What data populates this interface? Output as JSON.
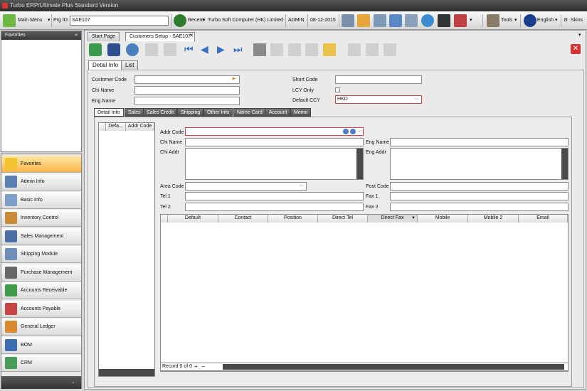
{
  "window": {
    "title": "Turbo ERP/Ultimate Plus Standard Version"
  },
  "toolbar": {
    "main_menu": "Main Menu",
    "prg_id_label": "Prg ID:",
    "prg_id_value": "SAE107",
    "recent": "Recent",
    "company": "Turbo Soft Computer (HK) Limited",
    "user": "ADMIN",
    "date": "08-12-2015",
    "tools": "Tools",
    "language": "English",
    "skins": "Skins"
  },
  "favorites": {
    "title": "Favorites"
  },
  "nav": {
    "items": [
      {
        "label": "Favorites",
        "icon": "star-icon"
      },
      {
        "label": "Admin Info",
        "icon": "admin-icon"
      },
      {
        "label": "Basic Info",
        "icon": "basic-info-icon"
      },
      {
        "label": "Inventory Control",
        "icon": "inventory-icon"
      },
      {
        "label": "Sales Management",
        "icon": "sales-icon"
      },
      {
        "label": "Shipping Module",
        "icon": "shipping-icon"
      },
      {
        "label": "Purchase Management",
        "icon": "purchase-icon"
      },
      {
        "label": "Accounts Receivable",
        "icon": "receivable-icon"
      },
      {
        "label": "Accounts Payable",
        "icon": "payable-icon"
      },
      {
        "label": "General Ledger",
        "icon": "ledger-icon"
      },
      {
        "label": "BOM",
        "icon": "bom-icon"
      },
      {
        "label": "CRM",
        "icon": "crm-icon"
      }
    ]
  },
  "doc_tabs": {
    "start": "Start Page",
    "current": "Customers Setup - SAE107"
  },
  "view_tabs": {
    "detail": "Detail Info",
    "list": "List"
  },
  "form": {
    "customer_code_label": "Customer Code",
    "chi_name_label": "Chi Name",
    "eng_name_label": "Eng Name",
    "short_code_label": "Short Code",
    "lcy_only_label": "LCY Only",
    "default_ccy_label": "Default CCY",
    "default_ccy_value": "HKD"
  },
  "detail_tabs": [
    "Detail Info",
    "Sales",
    "Sales Credit",
    "Shipping",
    "Other Info",
    "Name Card",
    "Account",
    "Memo"
  ],
  "addr_grid": {
    "headers": [
      "Defa...",
      "Addr Code"
    ]
  },
  "addr_form": {
    "addr_code_label": "Addr Code",
    "chi_name_label": "Chi Name",
    "eng_name_label": "Eng Name",
    "chi_addr_label": "Chi Addr",
    "eng_addr_label": "Eng Addr",
    "area_code_label": "Area Code",
    "post_code_label": "Post Code",
    "tel1_label": "Tel 1",
    "fax1_label": "Fax 1",
    "tel2_label": "Tel 2",
    "fax2_label": "Fax 2"
  },
  "contact_grid": {
    "headers": [
      "Default",
      "Contact",
      "Position",
      "Direct Tel",
      "Direct Fax",
      "Mobile",
      "Mobile 2",
      "Email"
    ],
    "record_text": "Record 0 of 0"
  },
  "colors": {
    "accent": "#f9b649",
    "required": "#cc4444",
    "close": "#d33333"
  }
}
